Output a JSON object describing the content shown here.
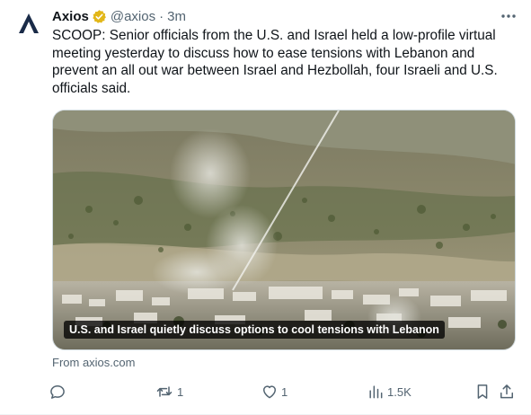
{
  "author": {
    "name": "Axios",
    "handle": "@axios",
    "separator": "·",
    "time": "3m"
  },
  "tweet_text": "SCOOP: Senior officials from the U.S. and Israel held a low-profile virtual meeting yesterday to discuss how to ease tensions with Lebanon and prevent an all out war between Israel and Hezbollah, four Israeli and U.S. officials said.",
  "card": {
    "caption": "U.S. and Israel quietly discuss options to cool tensions with Lebanon",
    "source": "From axios.com"
  },
  "actions": {
    "replies": "",
    "reposts": "1",
    "likes": "1",
    "views": "1.5K"
  },
  "colors": {
    "text": "#0f1419",
    "muted": "#536471",
    "verified_badge": "#e2b719",
    "avatar_logo": "#1a2b48"
  },
  "icons": {
    "avatar": "axios-logo",
    "verified": "verified-badge-icon",
    "more": "more-icon",
    "reply": "reply-icon",
    "repost": "repost-icon",
    "like": "heart-icon",
    "views": "views-icon",
    "bookmark": "bookmark-icon",
    "share": "share-icon"
  }
}
